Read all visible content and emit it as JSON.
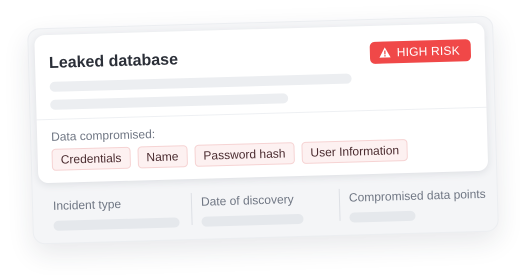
{
  "card": {
    "title": "Leaked database",
    "badge": {
      "label": "HIGH RISK",
      "icon": "warning-icon",
      "color": "#f04848"
    }
  },
  "compromised": {
    "label": "Data compromised:",
    "tags": [
      "Credentials",
      "Name",
      "Password hash",
      "User Information"
    ]
  },
  "meta": {
    "incident_type_label": "Incident type",
    "date_label": "Date of discovery",
    "data_points_label": "Compromised data points"
  }
}
